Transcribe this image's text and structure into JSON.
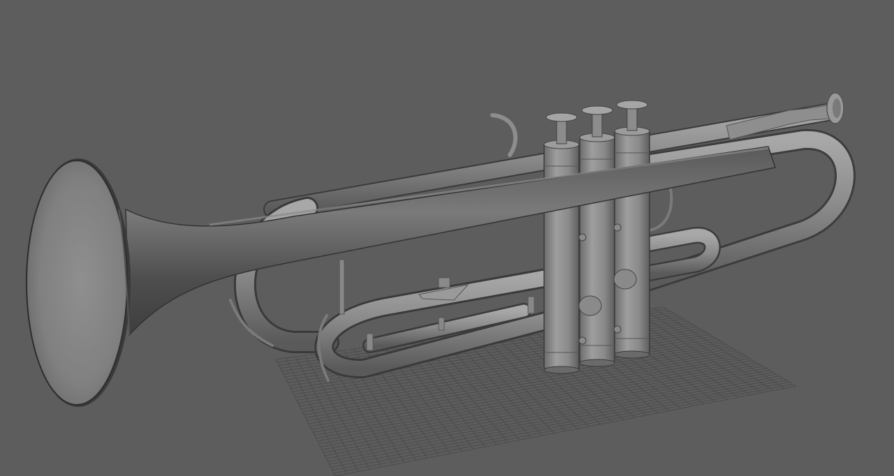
{
  "viewport": {
    "background": "#5d5d5d",
    "grid_visible": true,
    "grid_color": "#4c4c4c",
    "shading_mode": "smooth-shaded-gray",
    "model_color": "#8a8a8a",
    "model": "trumpet"
  }
}
